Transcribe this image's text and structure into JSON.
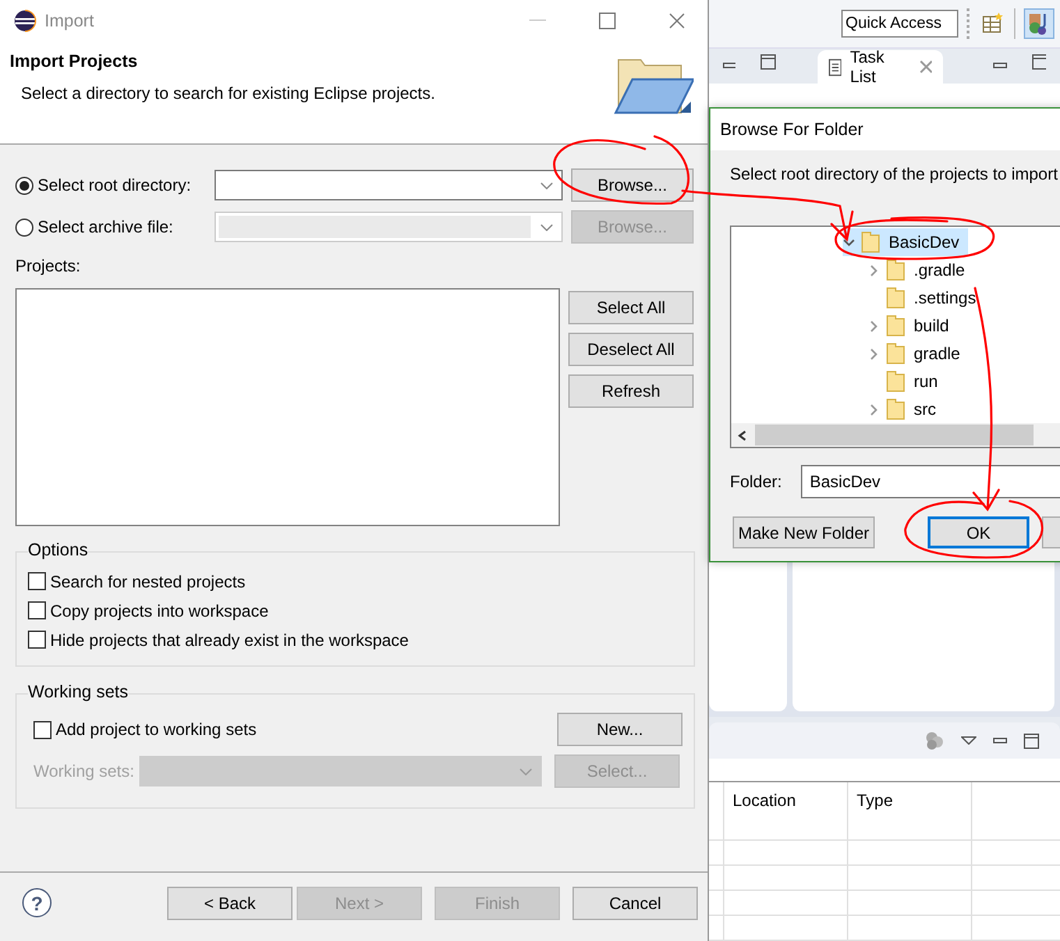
{
  "import_dialog": {
    "title": "Import",
    "header": {
      "title": "Import Projects",
      "description": "Select a directory to search for existing Eclipse projects."
    },
    "sources": [
      {
        "label": "Select root directory:",
        "selected": true,
        "disabled": false,
        "button": "Browse..."
      },
      {
        "label": "Select archive file:",
        "selected": false,
        "disabled": true,
        "button": "Browse..."
      }
    ],
    "projects_label": "Projects:",
    "project_buttons": [
      "Select All",
      "Deselect All",
      "Refresh"
    ],
    "options": {
      "title": "Options",
      "checkboxes": [
        {
          "label": "Search for nested projects",
          "checked": false
        },
        {
          "label": "Copy projects into workspace",
          "checked": false
        },
        {
          "label": "Hide projects that already exist in the workspace",
          "checked": false
        }
      ]
    },
    "working_sets": {
      "title": "Working sets",
      "checkbox": {
        "label": "Add project to working sets",
        "checked": false
      },
      "new_button": "New...",
      "field_label": "Working sets:",
      "select_button": "Select...",
      "disabled": true
    },
    "help": "?",
    "footer_buttons": [
      {
        "label": "< Back",
        "disabled": false
      },
      {
        "label": "Next >",
        "disabled": true
      },
      {
        "label": "Finish",
        "disabled": true
      },
      {
        "label": "Cancel",
        "disabled": false
      }
    ]
  },
  "workbench": {
    "quick_access": {
      "placeholder": "Quick Access"
    },
    "tab": "Task List",
    "table_columns": [
      "Location",
      "Type"
    ]
  },
  "folder_dialog": {
    "title": "Browse For Folder",
    "instruction": "Select root directory of the projects to import",
    "tree": {
      "label": "BasicDev",
      "expanded": true,
      "selected": true,
      "children": [
        {
          "label": ".gradle",
          "expandable": true,
          "selected": false
        },
        {
          "label": ".settings",
          "expandable": false,
          "selected": false
        },
        {
          "label": "build",
          "expandable": true,
          "selected": false
        },
        {
          "label": "gradle",
          "expandable": true,
          "selected": false
        },
        {
          "label": "run",
          "expandable": false,
          "selected": false
        },
        {
          "label": "src",
          "expandable": true,
          "selected": false
        }
      ]
    },
    "folder_label": "Folder:",
    "folder_value": "BasicDev",
    "buttons": [
      {
        "label": "Make New Folder",
        "default": false
      },
      {
        "label": "OK",
        "default": true
      }
    ]
  }
}
